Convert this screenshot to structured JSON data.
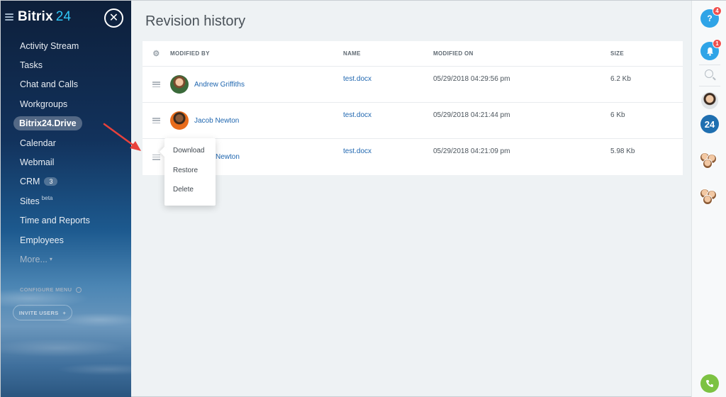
{
  "brand": {
    "name": "Bitrix",
    "number": "24"
  },
  "sidebar": {
    "items": [
      {
        "label": "Activity Stream"
      },
      {
        "label": "Tasks"
      },
      {
        "label": "Chat and Calls"
      },
      {
        "label": "Workgroups"
      },
      {
        "label": "Bitrix24.Drive",
        "active": true
      },
      {
        "label": "Calendar"
      },
      {
        "label": "Webmail"
      },
      {
        "label": "CRM",
        "badge": "3"
      },
      {
        "label": "Sites",
        "sup": "beta"
      },
      {
        "label": "Time and Reports"
      },
      {
        "label": "Employees"
      },
      {
        "label": "More..."
      }
    ],
    "configure_label": "CONFIGURE MENU",
    "invite_label": "INVITE USERS"
  },
  "main": {
    "title": "Revision history",
    "columns": {
      "modified_by": "MODIFIED BY",
      "name": "NAME",
      "modified_on": "MODIFIED ON",
      "size": "SIZE"
    },
    "rows": [
      {
        "user": "Andrew Griffiths",
        "name": "test.docx",
        "modified_on": "05/29/2018 04:29:56 pm",
        "size": "6.2 Kb"
      },
      {
        "user": "Jacob Newton",
        "name": "test.docx",
        "modified_on": "05/29/2018 04:21:44 pm",
        "size": "6 Kb"
      },
      {
        "user": "Newton",
        "name": "test.docx",
        "modified_on": "05/29/2018 04:21:09 pm",
        "size": "5.98 Kb"
      }
    ],
    "context_menu": [
      "Download",
      "Restore",
      "Delete"
    ]
  },
  "rightbar": {
    "help_label": "?",
    "help_count": "4",
    "bell_count": "1",
    "logo_label": "24"
  },
  "colors": {
    "accent": "#2fa4e7",
    "link": "#2067b0",
    "alert": "#f0504e",
    "phone": "#7cc242",
    "arrow": "#e8413b"
  }
}
